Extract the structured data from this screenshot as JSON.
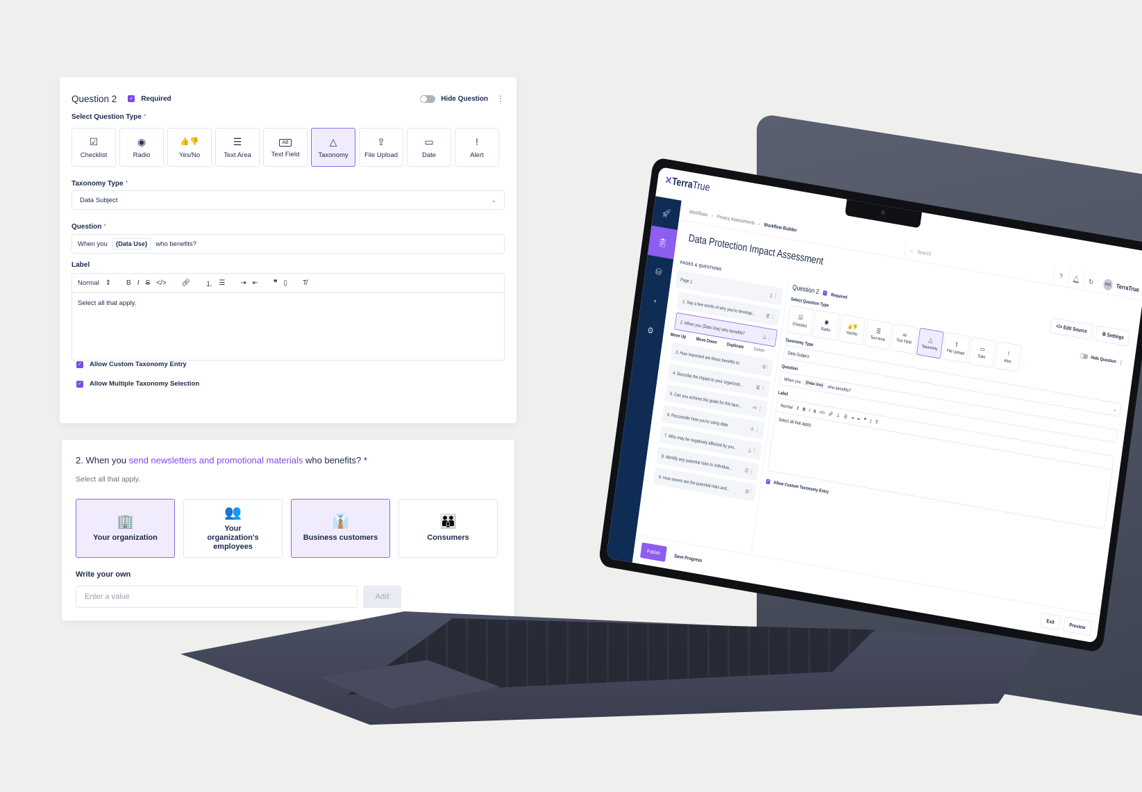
{
  "editor": {
    "question_title": "Question 2",
    "required_label": "Required",
    "hide_question_label": "Hide Question",
    "select_type_label": "Select Question Type",
    "required_mark": "*",
    "question_types": [
      {
        "label": "Checklist",
        "icon": "checkbox-icon",
        "glyph": "☑",
        "active": false
      },
      {
        "label": "Radio",
        "icon": "radio-icon",
        "glyph": "◉",
        "active": false
      },
      {
        "label": "Yes/No",
        "icon": "thumbs-up-down-icon",
        "glyph": "👍👎",
        "active": false
      },
      {
        "label": "Text Area",
        "icon": "text-area-icon",
        "glyph": "☰",
        "active": false
      },
      {
        "label": "Text Field",
        "icon": "text-field-icon",
        "glyph": "AB",
        "active": false
      },
      {
        "label": "Taxonomy",
        "icon": "shapes-icon",
        "glyph": "△",
        "active": true
      },
      {
        "label": "File Upload",
        "icon": "upload-icon",
        "glyph": "⇪",
        "active": false
      },
      {
        "label": "Date",
        "icon": "calendar-icon",
        "glyph": "▭",
        "active": false
      },
      {
        "label": "Alert",
        "icon": "alert-icon",
        "glyph": "!",
        "active": false
      }
    ],
    "taxonomy_type_label": "Taxonomy Type",
    "taxonomy_type_value": "Data Subject",
    "question_label": "Question",
    "question_parts": {
      "before": "When you",
      "token": "{Data Use}",
      "after": "who benefits?"
    },
    "label_label": "Label",
    "rte_style": "Normal",
    "rte_body": "Select all that apply.",
    "options": [
      {
        "label": "Allow Custom Taxonomy Entry",
        "checked": true
      },
      {
        "label": "Allow Multiple Taxonomy Selection",
        "checked": true
      }
    ]
  },
  "preview": {
    "question_prefix": "2. When you",
    "question_highlight": "send newsletters and promotional materials",
    "question_suffix": "who benefits?",
    "required_mark": "*",
    "subtitle": "Select all that apply.",
    "choices": [
      {
        "label": "Your organization",
        "icon": "building-icon",
        "glyph": "🏢",
        "selected": true
      },
      {
        "label": "Your organization's employees",
        "icon": "employees-network-icon",
        "glyph": "👥",
        "selected": false
      },
      {
        "label": "Business customers",
        "icon": "business-group-icon",
        "glyph": "👔",
        "selected": true
      },
      {
        "label": "Consumers",
        "icon": "consumers-icon",
        "glyph": "👪",
        "selected": false
      }
    ],
    "write_own_label": "Write your own",
    "input_placeholder": "Enter a value",
    "add_label": "Add"
  },
  "laptop_screen": {
    "logo_text_bold": "Terra",
    "logo_text_light": "True",
    "breadcrumbs": [
      "Workflows",
      "Privacy Assessments",
      "Workflow Builder"
    ],
    "search_placeholder": "Search",
    "avatar_initials": "PW",
    "org_name": "TerraTrue",
    "page_title": "Data Protection Impact Assessment",
    "edit_source_label": "Edit Source",
    "settings_label": "Settings",
    "pages_questions_label": "PAGES & QUESTIONS",
    "page_label": "Page 1",
    "questions": [
      {
        "text": "1. Say a few words of why you're developi...",
        "icon": "text-area-icon",
        "glyph": "☰",
        "active": false
      },
      {
        "text": "2. When you {Data Use} who benefits?",
        "icon": "shapes-icon",
        "glyph": "△",
        "active": true
      },
      {
        "text": "3. How important are these benefits to:",
        "icon": "taxonomy-icon",
        "glyph": "⛭",
        "active": false
      },
      {
        "text": "4. Describe the impact to your organizati...",
        "icon": "text-area-icon",
        "glyph": "☰",
        "active": false
      },
      {
        "text": "5. Can you achieve the goals for this laun...",
        "icon": "thumbs-up-icon",
        "glyph": "👍",
        "active": false
      },
      {
        "text": "6. Reconsider how you're using data",
        "icon": "alert-triangle-icon",
        "glyph": "⚠",
        "active": false
      },
      {
        "text": "7. Who may be negatively affected by you...",
        "icon": "shapes-icon",
        "glyph": "△",
        "active": false
      },
      {
        "text": "8. Identify any potential risks to individua...",
        "icon": "checkbox-icon",
        "glyph": "☑",
        "active": false
      },
      {
        "text": "9. How severe are the potential risks and...",
        "icon": "taxonomy-icon",
        "glyph": "⛭",
        "active": false
      }
    ],
    "item_actions": [
      "Move Up",
      "Move Down",
      "Duplicate",
      "Delete"
    ],
    "question_title": "Question 2",
    "required_label": "Required",
    "select_type_label": "Select Question Type",
    "hide_question_label": "Hide Question",
    "taxonomy_type_label": "Taxonomy Type",
    "taxonomy_type_value": "Data Subject",
    "question_label": "Question",
    "label_label": "Label",
    "rte_style": "Normal",
    "rte_body": "Select all that apply.",
    "allow_custom_label": "Allow Custom Taxonomy Entry",
    "publish_label": "Publish",
    "save_progress_label": "Save Progress",
    "exit_label": "Exit",
    "preview_label": "Preview"
  }
}
